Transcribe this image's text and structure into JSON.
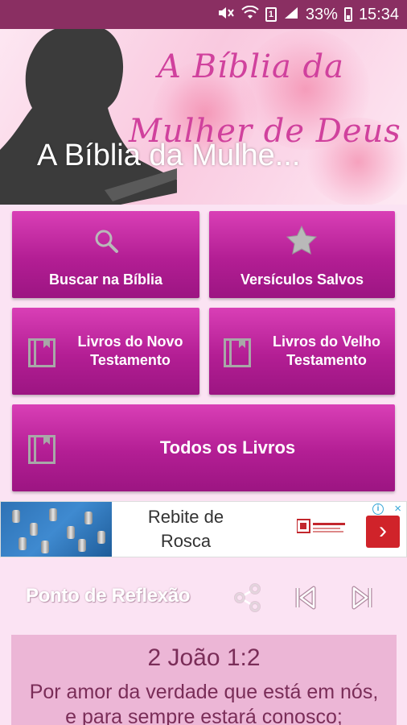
{
  "status_bar": {
    "battery": "33%",
    "time": "15:34",
    "sim_slot": "1"
  },
  "banner": {
    "script_line1": "A Bíblia da",
    "script_line2": "Mulher de Deus",
    "app_title": "A Bíblia da Mulhe..."
  },
  "tiles": {
    "search": "Buscar na Bíblia",
    "saved": "Versículos Salvos",
    "new_testament": "Livros do Novo Testamento",
    "old_testament": "Livros do Velho Testamento",
    "all_books": "Todos os Livros"
  },
  "ad": {
    "headline_line1": "Rebite de",
    "headline_line2": "Rosca",
    "info_glyph": "i",
    "close_glyph": "×",
    "cta_glyph": "›"
  },
  "reflection": {
    "title": "Ponto de Reflexão"
  },
  "verse": {
    "reference": "2 João 1:2",
    "line1": "Por amor da verdade que está em nós,",
    "line2": "e para sempre estará conosco;"
  },
  "colors": {
    "status_bar": "#8a2f62",
    "tile": "#b31e94",
    "background": "#fbe3f3",
    "verse_card": "#ecb6d6",
    "ad_cta": "#d0232a"
  }
}
